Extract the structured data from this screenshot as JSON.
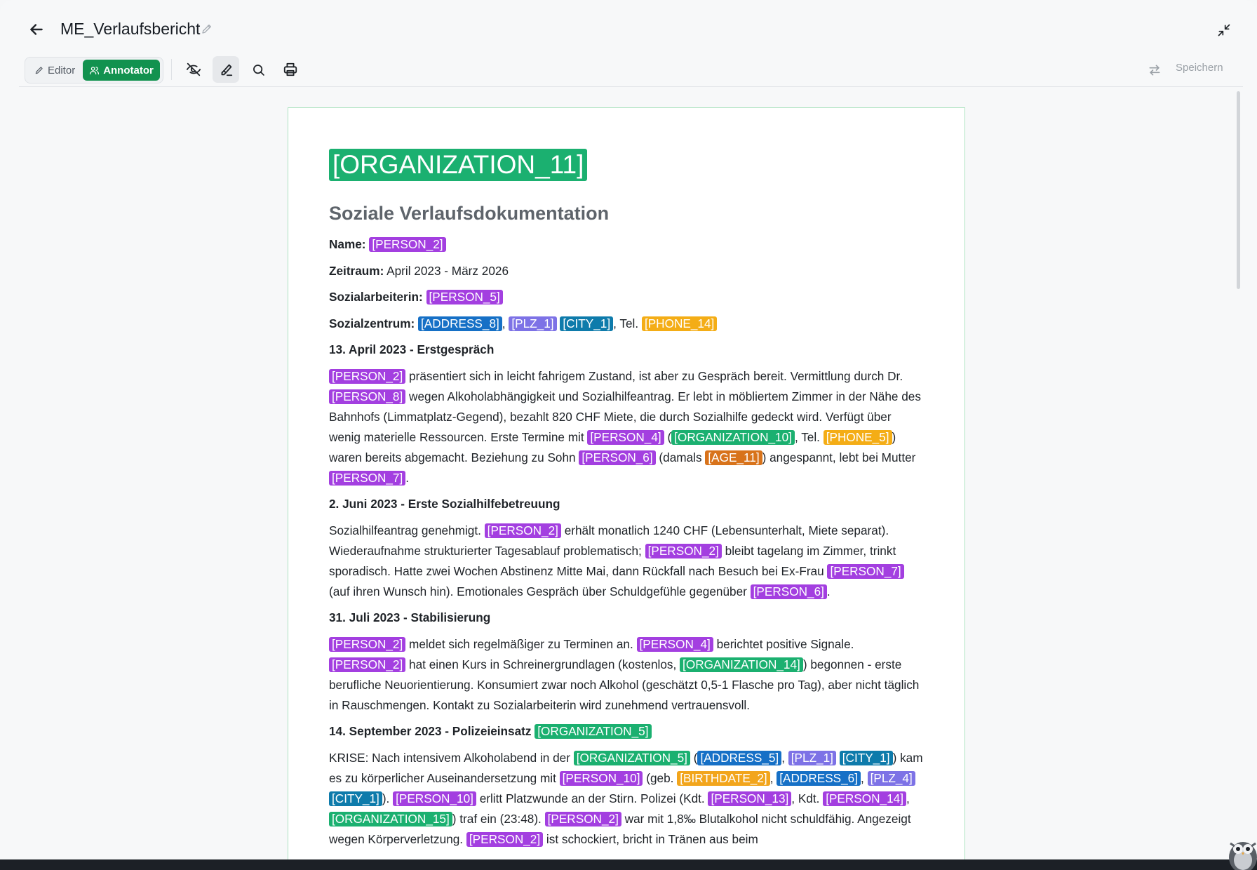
{
  "header": {
    "title": "ME_Verlaufsbericht"
  },
  "toolbar": {
    "modes": [
      {
        "label": "Editor",
        "active": false
      },
      {
        "label": "Annotator",
        "active": true
      }
    ],
    "tools": [
      "eye-off-icon",
      "highlighter-icon",
      "search-icon",
      "print-icon"
    ],
    "save_label": "Speichern"
  },
  "colors": {
    "accent": "#12924f",
    "person": "#a33fe0",
    "organization": "#1bb070",
    "address": "#1670c6",
    "plz": "#7d72e6",
    "city": "#0e7bab",
    "phone": "#f4ad16",
    "age": "#d8731b",
    "birthdate": "#f2a51c"
  },
  "document": {
    "org_heading": "[ORGANIZATION_11]",
    "subtitle": "Soziale Verlaufsdokumentation",
    "name_label": "Name:",
    "name_value": "[PERSON_2]",
    "zeitraum_label": "Zeitraum:",
    "zeitraum_value": "April 2023 - März 2026",
    "sozialarbeiterin_label": "Sozialarbeiterin:",
    "sozialarbeiterin_value": "[PERSON_5]",
    "sozialzentrum_label": "Sozialzentrum:",
    "sozialzentrum_address": "[ADDRESS_8]",
    "sozialzentrum_plz": "[PLZ_1]",
    "sozialzentrum_city": "[CITY_1]",
    "sozialzentrum_tel": ", Tel.",
    "sozialzentrum_phone": "[PHONE_14]",
    "s1": {
      "heading": "13. April 2023 - Erstgespräch",
      "t1": "[PERSON_2]",
      "p1": " präsentiert sich in leicht fahrigem Zustand, ist aber zu Gespräch bereit. Vermittlung durch Dr. ",
      "t2": "[PERSON_8]",
      "p2": " wegen Alkoholabhängigkeit und Sozialhilfeantrag. Er lebt in möbliertem Zimmer in der Nähe des Bahnhofs (Limmatplatz-Gegend), bezahlt 820 CHF Miete, die durch Sozialhilfe gedeckt wird. Verfügt über wenig materielle Ressourcen. Erste Termine mit ",
      "t3": "[PERSON_4]",
      "p3": " (",
      "t4": "[ORGANIZATION_10]",
      "p4": ", Tel. ",
      "t5": "[PHONE_5]",
      "p5": ") waren bereits abgemacht. Beziehung zu Sohn ",
      "t6": "[PERSON_6]",
      "p6": " (damals ",
      "t7": "[AGE_11]",
      "p7": ") angespannt, lebt bei Mutter ",
      "t8": "[PERSON_7]",
      "p8": "."
    },
    "s2": {
      "heading": "2. Juni 2023 - Erste Sozialhilfebetreuung",
      "p1": "Sozialhilfeantrag genehmigt. ",
      "t1": "[PERSON_2]",
      "p2": " erhält monatlich 1240 CHF (Lebensunterhalt, Miete separat). Wiederaufnahme strukturierter Tagesablauf problematisch; ",
      "t2": "[PERSON_2]",
      "p3": " bleibt tagelang im Zimmer, trinkt sporadisch. Hatte zwei Wochen Abstinenz Mitte Mai, dann Rückfall nach Besuch bei Ex-Frau ",
      "t3": "[PERSON_7]",
      "p4": " (auf ihren Wunsch hin). Emotionales Gespräch über Schuldgefühle gegenüber ",
      "t4": "[PERSON_6]",
      "p5": "."
    },
    "s3": {
      "heading": "31. Juli 2023 - Stabilisierung",
      "t1": "[PERSON_2]",
      "p1": " meldet sich regelmäßiger zu Terminen an. ",
      "t2": "[PERSON_4]",
      "p2": " berichtet positive Signale. ",
      "t3": "[PERSON_2]",
      "p3": " hat einen Kurs in Schreinergrundlagen (kostenlos, ",
      "t4": "[ORGANIZATION_14]",
      "p4": ") begonnen - erste berufliche Neuorientierung. Konsumiert zwar noch Alkohol (geschätzt 0,5-1 Flasche pro Tag), aber nicht täglich in Rauschmengen. Kontakt zu Sozialarbeiterin wird zunehmend vertrauensvoll."
    },
    "s4": {
      "heading": "14. September 2023 - Polizeieinsatz ",
      "heading_tag": "[ORGANIZATION_5]",
      "p1": "KRISE: Nach intensivem Alkoholabend in der ",
      "t1": "[ORGANIZATION_5]",
      "p2": " (",
      "t2": "[ADDRESS_5]",
      "p3": ", ",
      "t3": "[PLZ_1]",
      "p4": " ",
      "t4": "[CITY_1]",
      "p5": ") kam es zu körperlicher Auseinandersetzung mit ",
      "t5": "[PERSON_10]",
      "p6": " (geb. ",
      "t6": "[BIRTHDATE_2]",
      "p7": ", ",
      "t7": "[ADDRESS_6]",
      "p8": ", ",
      "t8": "[PLZ_4]",
      "p9": " ",
      "t9": "[CITY_1]",
      "p10": "). ",
      "t10": "[PERSON_10]",
      "p11": " erlitt Platzwunde an der Stirn. Polizei (Kdt. ",
      "t11": "[PERSON_13]",
      "p12": ", Kdt. ",
      "t12": "[PERSON_14]",
      "p13": ", ",
      "t13": "[ORGANIZATION_15]",
      "p14": ") traf ein (23:48). ",
      "t14": "[PERSON_2]",
      "p15": " war mit 1,8‰ Blutalkohol nicht schuldfähig. Angezeigt wegen Körperverletzung. ",
      "t15": "[PERSON_2]",
      "p16": " ist schockiert, bricht in Tränen aus beim"
    }
  }
}
